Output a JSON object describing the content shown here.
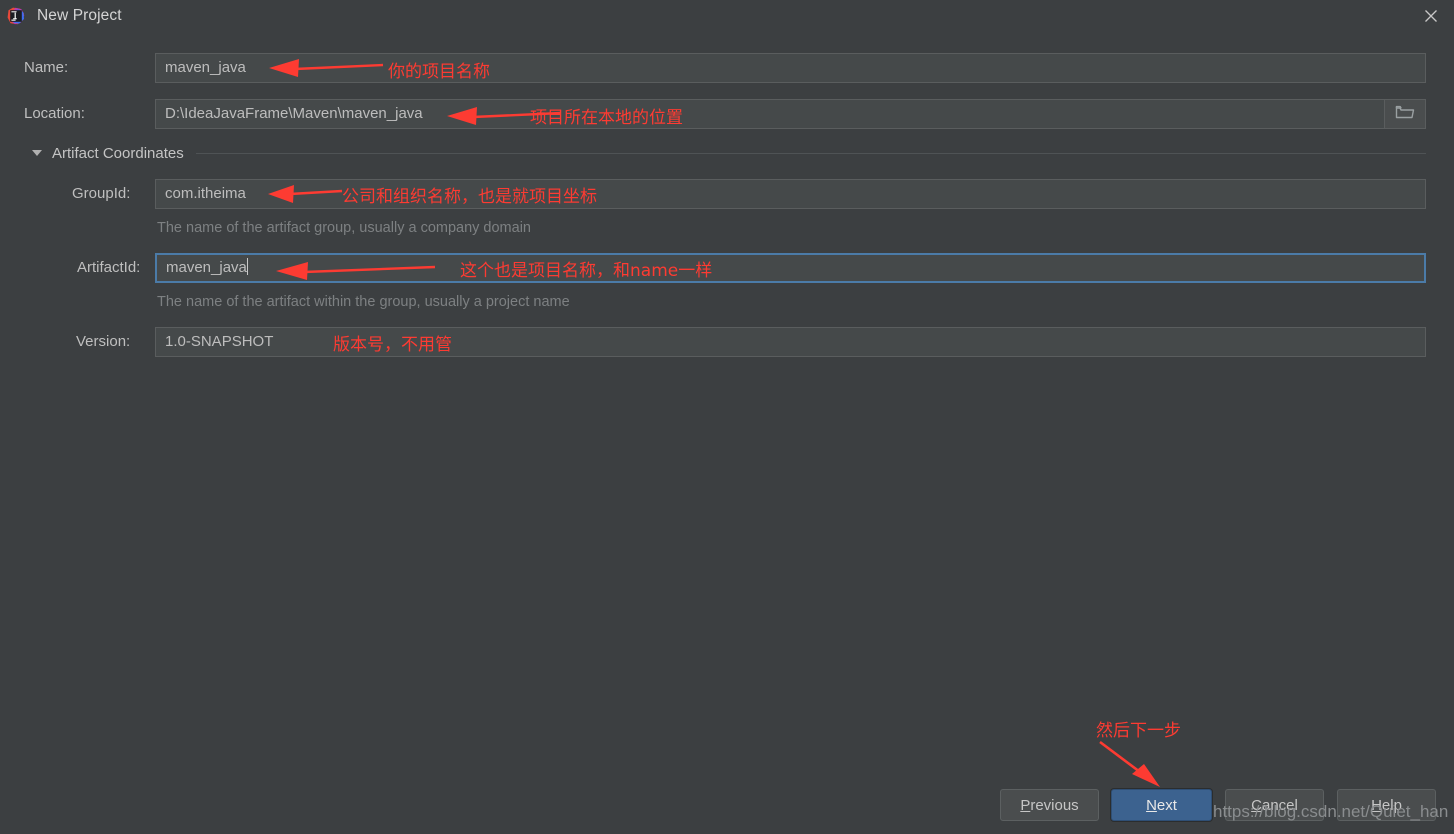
{
  "window": {
    "title": "New Project",
    "app_icon": "intellij-idea-icon",
    "close_icon": "close-icon"
  },
  "form": {
    "fields": [
      {
        "label": "Name:",
        "value": "maven_java",
        "hint": ""
      },
      {
        "label": "Location:",
        "value": "D:\\IdeaJavaFrame\\Maven\\maven_java",
        "hint": ""
      },
      {
        "label": "GroupId:",
        "value": "com.itheima",
        "hint": "The name of the artifact group, usually a company domain"
      },
      {
        "label": "ArtifactId:",
        "value": "maven_java",
        "hint": "The name of the artifact within the group, usually a project name"
      },
      {
        "label": "Version:",
        "value": "1.0-SNAPSHOT",
        "hint": ""
      }
    ],
    "section": {
      "title": "Artifact Coordinates",
      "expanded_icon": "triangle-down-icon"
    },
    "browse_icon": "folder-icon"
  },
  "annotations": [
    {
      "text": "你的项目名称"
    },
    {
      "text": "项目所在本地的位置"
    },
    {
      "text": "公司和组织名称，也是就项目坐标"
    },
    {
      "text": "这个也是项目名称，和name一样"
    },
    {
      "text": "版本号，不用管"
    },
    {
      "text": "然后下一步"
    }
  ],
  "buttons": {
    "previous": {
      "pre": "",
      "mnemonic": "P",
      "post": "revious"
    },
    "next": {
      "pre": "",
      "mnemonic": "N",
      "post": "ext"
    },
    "cancel": {
      "pre": "",
      "mnemonic": "C",
      "post": "ancel"
    },
    "help": {
      "pre": "",
      "mnemonic": "H",
      "post": "elp"
    },
    "next_accent_color": "#3c628f"
  },
  "watermark": {
    "url": "https://blog.csdn.net/Quiet_han"
  }
}
